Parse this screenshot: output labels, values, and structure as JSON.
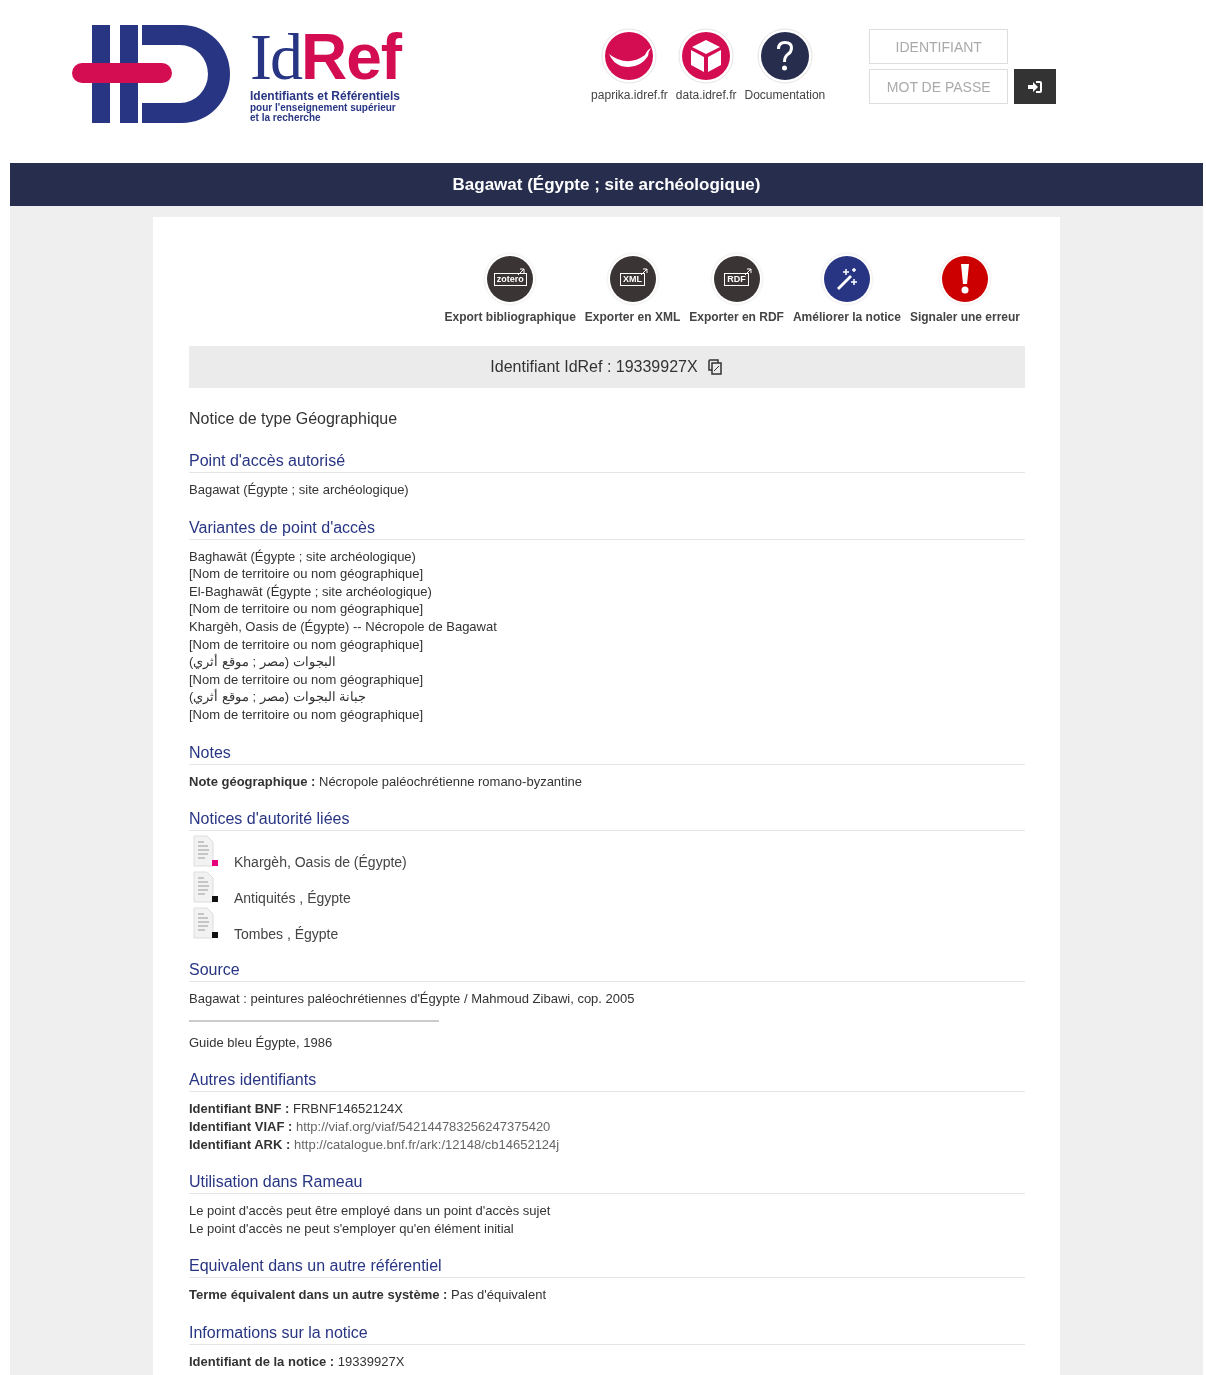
{
  "header": {
    "logo": {
      "id": "Id",
      "ref": "Ref",
      "tagline": [
        "Identifiants et Référentiels",
        "pour l'enseignement supérieur",
        "et la recherche"
      ]
    },
    "links": [
      {
        "label": "paprika.idref.fr",
        "kind": "paprika"
      },
      {
        "label": "data.idref.fr",
        "kind": "data"
      },
      {
        "label": "Documentation",
        "kind": "help"
      }
    ],
    "login": {
      "username_placeholder": "IDENTIFIANT",
      "password_placeholder": "MOT DE PASSE"
    }
  },
  "title": "Bagawat (Égypte ; site archéologique)",
  "actions": [
    {
      "label": "Export bibliographique",
      "kind": "tag",
      "icon_text": "zotero"
    },
    {
      "label": "Exporter en XML",
      "kind": "tag",
      "icon_text": "XML"
    },
    {
      "label": "Exporter en RDF",
      "kind": "tag",
      "icon_text": "RDF"
    },
    {
      "label": "Améliorer la notice",
      "kind": "wand"
    },
    {
      "label": "Signaler une erreur",
      "kind": "alert"
    }
  ],
  "identifier": "Identifiant IdRef : 19339927X",
  "notice_type": "Notice de type Géographique",
  "sections": [
    {
      "heading": "Point d'accès autorisé",
      "kind": "lines",
      "lines": [
        "Bagawat (Égypte ; site archéologique)"
      ]
    },
    {
      "heading": "Variantes de point d'accès",
      "kind": "lines",
      "lines": [
        "Baghawāt (Égypte ; site archéologique)",
        "[Nom de territoire ou nom géographique]",
        "El-Baghawāt (Égypte ; site archéologique)",
        "[Nom de territoire ou nom géographique]",
        "Khargèh, Oasis de (Égypte) -- Nécropole de Bagawat",
        "[Nom de territoire ou nom géographique]",
        "البجوات (مصر ; موقع أثري)",
        "[Nom de territoire ou nom géographique]",
        "جبانة البجوات (مصر ; موقع أثري)",
        "[Nom de territoire ou nom géographique]"
      ]
    },
    {
      "heading": "Notes",
      "kind": "fields",
      "fields": [
        {
          "label": "Note géographique :",
          "value": "Nécropole paléochrétienne romano-byzantine",
          "link": false
        }
      ]
    },
    {
      "heading": "Notices d'autorité liées",
      "kind": "links",
      "items": [
        {
          "label": "Khargèh, Oasis de (Égypte)",
          "color": "#e6007e"
        },
        {
          "label": "Antiquités , Égypte",
          "color": "#111111"
        },
        {
          "label": "Tombes , Égypte",
          "color": "#111111"
        }
      ]
    },
    {
      "heading": "Source",
      "kind": "sources",
      "lines": [
        "Bagawat : peintures paléochrétiennes d'Égypte / Mahmoud Zibawi, cop. 2005",
        "Guide bleu Égypte, 1986"
      ]
    },
    {
      "heading": "Autres identifiants",
      "kind": "fields",
      "fields": [
        {
          "label": "Identifiant BNF :",
          "value": "FRBNF14652124X",
          "link": false
        },
        {
          "label": "Identifiant VIAF :",
          "value": "http://viaf.org/viaf/542144783256247375420",
          "link": true
        },
        {
          "label": "Identifiant ARK :",
          "value": "http://catalogue.bnf.fr/ark:/12148/cb14652124j",
          "link": true
        }
      ]
    },
    {
      "heading": "Utilisation dans Rameau",
      "kind": "lines",
      "lines": [
        "Le point d'accès peut être employé dans un point d'accès sujet",
        "Le point d'accès ne peut s'employer qu'en élément initial"
      ]
    },
    {
      "heading": "Equivalent dans un autre référentiel",
      "kind": "fields",
      "fields": [
        {
          "label": "Terme équivalent dans un autre système :",
          "value": "Pas d'équivalent",
          "link": false
        }
      ]
    },
    {
      "heading": "Informations sur la notice",
      "kind": "fields",
      "fields": [
        {
          "label": "Identifiant de la notice :",
          "value": "19339927X",
          "link": false
        }
      ]
    }
  ]
}
